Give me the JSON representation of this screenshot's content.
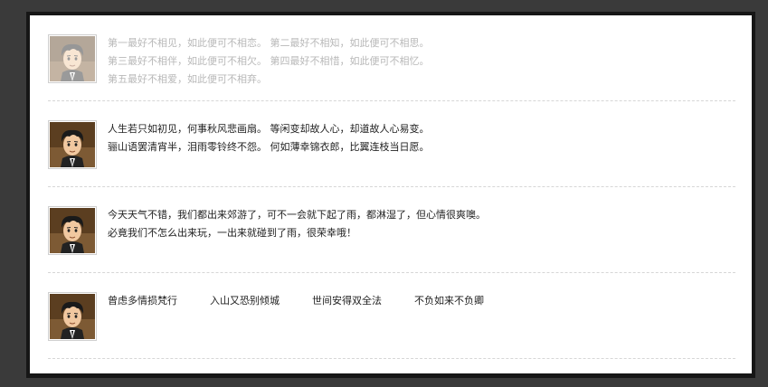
{
  "posts": [
    {
      "faded": true,
      "lines": [
        "第一最好不相见，如此便可不相恋。  第二最好不相知，如此便可不相思。",
        "第三最好不相伴，如此便可不相欠。  第四最好不相惜，如此便可不相忆。",
        "第五最好不相爱，如此便可不相弃。"
      ]
    },
    {
      "faded": false,
      "lines": [
        "人生若只如初见，何事秋风悲画扇。  等闲变却故人心，却道故人心易变。",
        "骊山语罢清宵半，泪雨零铃终不怨。  何如薄幸锦衣郎，比翼连枝当日愿。"
      ]
    },
    {
      "faded": false,
      "lines": [
        "今天天气不错，我们都出来郊游了，可不一会就下起了雨，都淋湿了，但心情很爽噢。",
        "必竟我们不怎么出来玩，一出来就碰到了雨，很荣幸哦！"
      ]
    },
    {
      "faded": false,
      "tags": [
        "曾虑多情损梵行",
        "入山又恐别倾城",
        "世间安得双全法",
        "不负如来不负卿"
      ]
    }
  ],
  "icons": {
    "avatar": "cartoon-man-avatar-icon"
  }
}
